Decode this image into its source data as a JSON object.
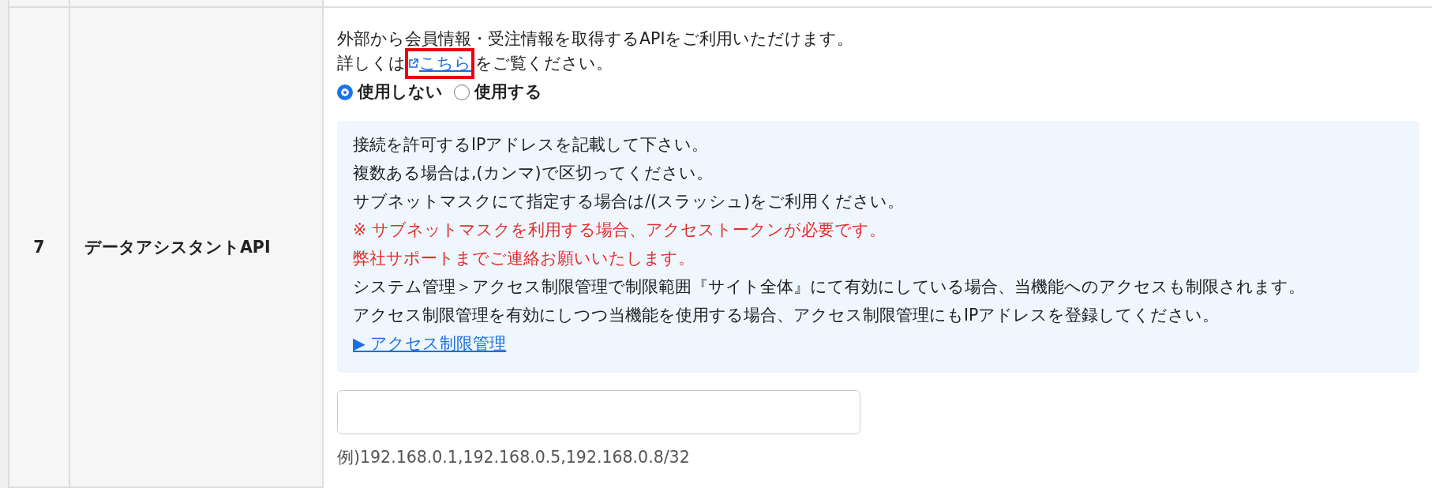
{
  "row": {
    "number": "7",
    "label": "データアシスタントAPI"
  },
  "description": {
    "line_1": "外部から会員情報・受注情報を取得するAPIをご利用いただけます。",
    "before_link": "詳しくは",
    "link": {
      "text": "こちら",
      "highlighted": true
    },
    "after_link": "をご覧ください。"
  },
  "radios": [
    {
      "label": "使用しない",
      "selected": true
    },
    {
      "label": "使用する",
      "selected": false
    }
  ],
  "notes": [
    {
      "kind": "normal",
      "text": "接続を許可するIPアドレスを記載して下さい。"
    },
    {
      "kind": "normal",
      "text": "複数ある場合は,(カンマ)で区切ってください。"
    },
    {
      "kind": "normal",
      "text": "サブネットマスクにて指定する場合は/(スラッシュ)をご利用ください。"
    },
    {
      "kind": "warning",
      "text": "※ サブネットマスクを利用する場合、アクセストークンが必要です。"
    },
    {
      "kind": "warning",
      "text": "弊社サポートまでご連絡お願いいたします。"
    },
    {
      "kind": "normal",
      "text": "システム管理＞アクセス制限管理で制限範囲『サイト全体』にて有効にしている場合、当機能へのアクセスも制限されます。"
    },
    {
      "kind": "normal",
      "text": "アクセス制限管理を有効にしつつ当機能を使用する場合、アクセス制限管理にもIPアドレスを登録してください。"
    },
    {
      "kind": "link",
      "text": "▶ アクセス制限管理"
    }
  ],
  "ip_field": {
    "hint": "例)192.168.0.1,192.168.0.5,192.168.0.8/32"
  }
}
